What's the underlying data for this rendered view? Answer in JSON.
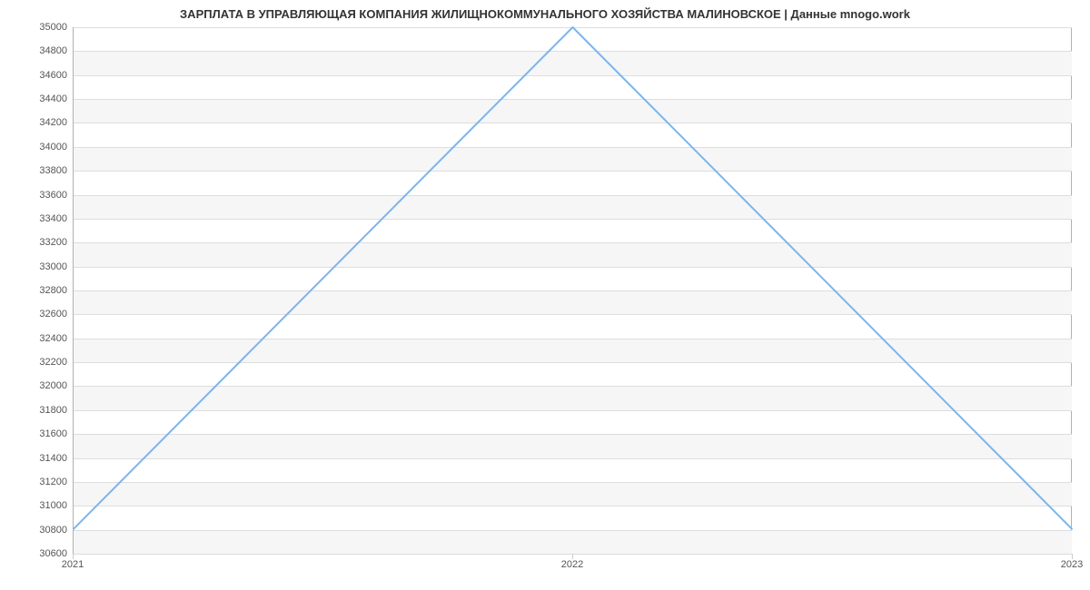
{
  "chart_data": {
    "type": "line",
    "title": "ЗАРПЛАТА В УПРАВЛЯЮЩАЯ КОМПАНИЯ ЖИЛИЩНОКОММУНАЛЬНОГО ХОЗЯЙСТВА МАЛИНОВСКОЕ | Данные mnogo.work",
    "categories": [
      "2021",
      "2022",
      "2023"
    ],
    "values": [
      30800,
      35000,
      30800
    ],
    "xlabel": "",
    "ylabel": "",
    "ylim": [
      30600,
      35000
    ],
    "yticks": [
      30600,
      30800,
      31000,
      31200,
      31400,
      31600,
      31800,
      32000,
      32200,
      32400,
      32600,
      32800,
      33000,
      33200,
      33400,
      33600,
      33800,
      34000,
      34200,
      34400,
      34600,
      34800,
      35000
    ]
  }
}
